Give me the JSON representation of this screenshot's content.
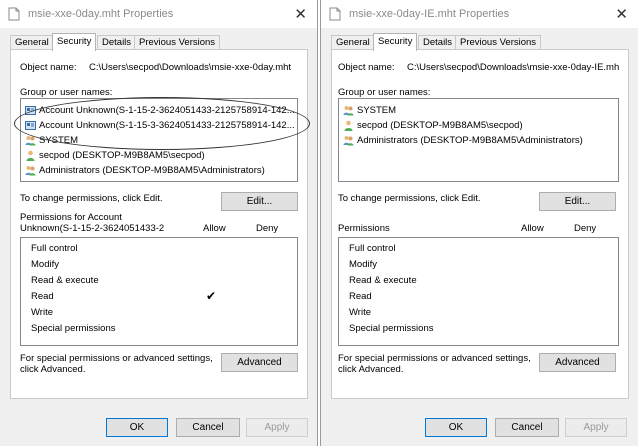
{
  "left": {
    "title": "msie-xxe-0day.mht Properties",
    "tabs": [
      "General",
      "Security",
      "Details",
      "Previous Versions"
    ],
    "object_name_label": "Object name:",
    "object_name_value": "C:\\Users\\secpod\\Downloads\\msie-xxe-0day.mht",
    "group_label": "Group or user names:",
    "users": [
      {
        "name": "Account Unknown(S-1-15-2-3624051433-2125758914-142...",
        "icon": "unknown-account-icon"
      },
      {
        "name": "Account Unknown(S-1-15-3-3624051433-2125758914-142...",
        "icon": "unknown-account-icon"
      },
      {
        "name": "SYSTEM",
        "icon": "user-group-icon"
      },
      {
        "name": "secpod (DESKTOP-M9B8AM5\\secpod)",
        "icon": "user-icon"
      },
      {
        "name": "Administrators (DESKTOP-M9B8AM5\\Administrators)",
        "icon": "user-group-icon"
      }
    ],
    "change_hint": "To change permissions, click Edit.",
    "edit_label": "Edit...",
    "perm_header_line1": "Permissions for Account",
    "perm_header_line2": "Unknown(S-1-15-2-3624051433-2",
    "allow_label": "Allow",
    "deny_label": "Deny",
    "permissions": [
      "Full control",
      "Modify",
      "Read & execute",
      "Read",
      "Write",
      "Special permissions"
    ],
    "read_allow_mark": "✔",
    "advanced_hint_line1": "For special permissions or advanced settings,",
    "advanced_hint_line2": "click Advanced.",
    "advanced_label": "Advanced",
    "ok_label": "OK",
    "cancel_label": "Cancel",
    "apply_label": "Apply"
  },
  "right": {
    "title": "msie-xxe-0day-IE.mht Properties",
    "tabs": [
      "General",
      "Security",
      "Details",
      "Previous Versions"
    ],
    "object_name_label": "Object name:",
    "object_name_value": "C:\\Users\\secpod\\Downloads\\msie-xxe-0day-IE.mh",
    "group_label": "Group or user names:",
    "users": [
      {
        "name": "SYSTEM",
        "icon": "user-group-icon"
      },
      {
        "name": "secpod (DESKTOP-M9B8AM5\\secpod)",
        "icon": "user-icon"
      },
      {
        "name": "Administrators (DESKTOP-M9B8AM5\\Administrators)",
        "icon": "user-group-icon"
      }
    ],
    "change_hint": "To change permissions, click Edit.",
    "edit_label": "Edit...",
    "perm_header": "Permissions",
    "allow_label": "Allow",
    "deny_label": "Deny",
    "permissions": [
      "Full control",
      "Modify",
      "Read & execute",
      "Read",
      "Write",
      "Special permissions"
    ],
    "advanced_hint_line1": "For special permissions or advanced settings,",
    "advanced_hint_line2": "click Advanced.",
    "advanced_label": "Advanced",
    "ok_label": "OK",
    "cancel_label": "Cancel",
    "apply_label": "Apply"
  },
  "colors": {
    "primary_button_border": "#0078d7",
    "highlight_oval": "#333333"
  }
}
